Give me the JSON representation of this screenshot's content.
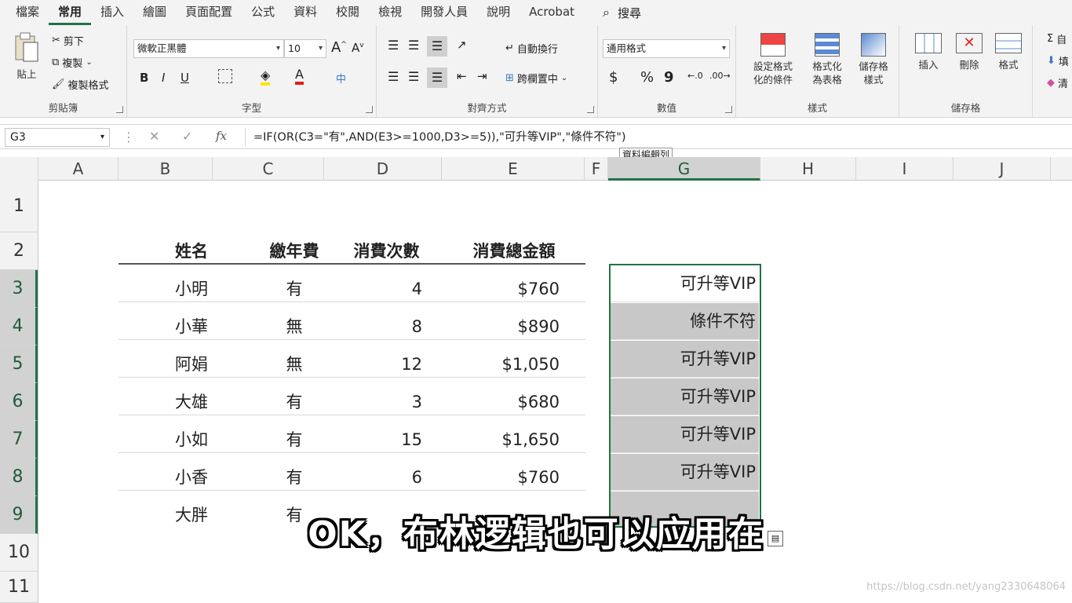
{
  "menu": {
    "tabs": [
      "檔案",
      "常用",
      "插入",
      "繪圖",
      "頁面配置",
      "公式",
      "資料",
      "校閱",
      "檢視",
      "開發人員",
      "說明",
      "Acrobat"
    ],
    "active_tab": "常用",
    "search_label": "搜尋"
  },
  "ribbon": {
    "clipboard": {
      "title": "剪貼簿",
      "paste": "貼上",
      "cut": "剪下",
      "copy": "複製",
      "format_painter": "複製格式"
    },
    "font": {
      "title": "字型",
      "font_name": "微軟正黑體",
      "font_size": "10",
      "bold": "B",
      "italic": "I",
      "underline": "U"
    },
    "alignment": {
      "title": "對齊方式",
      "wrap_text": "自動換行",
      "merge_center": "跨欄置中"
    },
    "number": {
      "title": "數值",
      "format": "通用格式",
      "currency": "$",
      "percent": "%",
      "comma": "9"
    },
    "styles": {
      "title": "樣式",
      "conditional": "設定格式化的條件",
      "format_table": "格式化為表格",
      "cell_styles": "儲存格樣式"
    },
    "cells": {
      "title": "儲存格",
      "insert": "插入",
      "delete": "刪除",
      "format": "格式"
    },
    "editing": {
      "autosum_partial": "自",
      "fill_partial": "填",
      "clear_partial": "清"
    }
  },
  "formula_bar": {
    "name_box": "G3",
    "cancel": "✕",
    "enter": "✓",
    "fx": "fx",
    "formula": "=IF(OR(C3=\"有\",AND(E3>=1000,D3>=5)),\"可升等VIP\",\"條件不符\")",
    "tooltip": "資料編輯列"
  },
  "columns": [
    "A",
    "B",
    "C",
    "D",
    "E",
    "F",
    "G",
    "H",
    "I",
    "J"
  ],
  "selected_column": "G",
  "rows": [
    "1",
    "2",
    "3",
    "4",
    "5",
    "6",
    "7",
    "8",
    "9",
    "10",
    "11"
  ],
  "table": {
    "headers": [
      "姓名",
      "繳年費",
      "消費次數",
      "消費總金額"
    ],
    "records": [
      {
        "name": "小明",
        "fee": "有",
        "count": "4",
        "amount": "$760"
      },
      {
        "name": "小華",
        "fee": "無",
        "count": "8",
        "amount": "$890"
      },
      {
        "name": "阿娟",
        "fee": "無",
        "count": "12",
        "amount": "$1,050"
      },
      {
        "name": "大雄",
        "fee": "有",
        "count": "3",
        "amount": "$680"
      },
      {
        "name": "小如",
        "fee": "有",
        "count": "15",
        "amount": "$1,650"
      },
      {
        "name": "小香",
        "fee": "有",
        "count": "6",
        "amount": "$760"
      },
      {
        "name": "大胖",
        "fee": "有",
        "count": "",
        "amount": ""
      }
    ],
    "results": [
      "可升等VIP",
      "條件不符",
      "可升等VIP",
      "可升等VIP",
      "可升等VIP",
      "可升等VIP"
    ]
  },
  "subtitle": "OK，布林逻辑也可以应用在",
  "watermark": "https://blog.csdn.net/yang2330648064",
  "colors": {
    "accent": "#217346",
    "selection": "#c8c8c8"
  }
}
